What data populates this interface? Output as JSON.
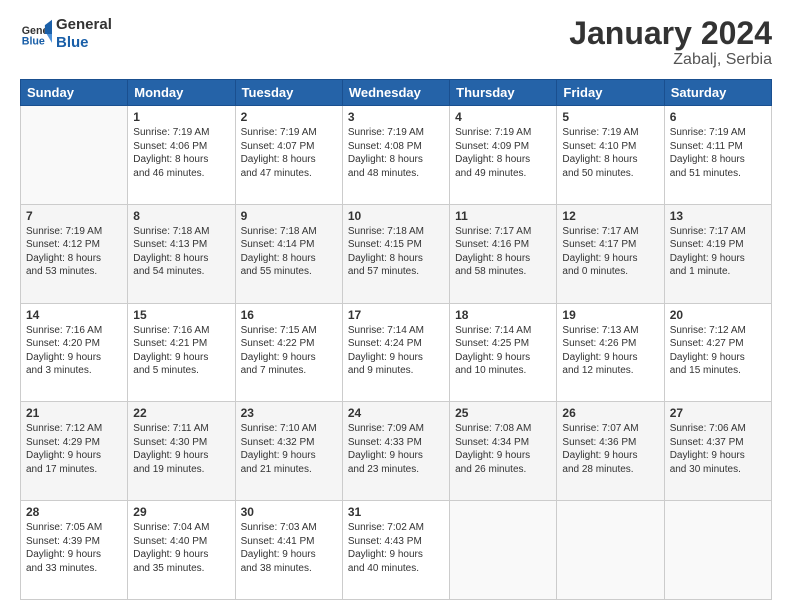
{
  "header": {
    "logo_line1": "General",
    "logo_line2": "Blue",
    "title": "January 2024",
    "subtitle": "Zabalj, Serbia"
  },
  "weekdays": [
    "Sunday",
    "Monday",
    "Tuesday",
    "Wednesday",
    "Thursday",
    "Friday",
    "Saturday"
  ],
  "weeks": [
    [
      {
        "day": "",
        "content": ""
      },
      {
        "day": "1",
        "content": "Sunrise: 7:19 AM\nSunset: 4:06 PM\nDaylight: 8 hours\nand 46 minutes."
      },
      {
        "day": "2",
        "content": "Sunrise: 7:19 AM\nSunset: 4:07 PM\nDaylight: 8 hours\nand 47 minutes."
      },
      {
        "day": "3",
        "content": "Sunrise: 7:19 AM\nSunset: 4:08 PM\nDaylight: 8 hours\nand 48 minutes."
      },
      {
        "day": "4",
        "content": "Sunrise: 7:19 AM\nSunset: 4:09 PM\nDaylight: 8 hours\nand 49 minutes."
      },
      {
        "day": "5",
        "content": "Sunrise: 7:19 AM\nSunset: 4:10 PM\nDaylight: 8 hours\nand 50 minutes."
      },
      {
        "day": "6",
        "content": "Sunrise: 7:19 AM\nSunset: 4:11 PM\nDaylight: 8 hours\nand 51 minutes."
      }
    ],
    [
      {
        "day": "7",
        "content": "Sunrise: 7:19 AM\nSunset: 4:12 PM\nDaylight: 8 hours\nand 53 minutes."
      },
      {
        "day": "8",
        "content": "Sunrise: 7:18 AM\nSunset: 4:13 PM\nDaylight: 8 hours\nand 54 minutes."
      },
      {
        "day": "9",
        "content": "Sunrise: 7:18 AM\nSunset: 4:14 PM\nDaylight: 8 hours\nand 55 minutes."
      },
      {
        "day": "10",
        "content": "Sunrise: 7:18 AM\nSunset: 4:15 PM\nDaylight: 8 hours\nand 57 minutes."
      },
      {
        "day": "11",
        "content": "Sunrise: 7:17 AM\nSunset: 4:16 PM\nDaylight: 8 hours\nand 58 minutes."
      },
      {
        "day": "12",
        "content": "Sunrise: 7:17 AM\nSunset: 4:17 PM\nDaylight: 9 hours\nand 0 minutes."
      },
      {
        "day": "13",
        "content": "Sunrise: 7:17 AM\nSunset: 4:19 PM\nDaylight: 9 hours\nand 1 minute."
      }
    ],
    [
      {
        "day": "14",
        "content": "Sunrise: 7:16 AM\nSunset: 4:20 PM\nDaylight: 9 hours\nand 3 minutes."
      },
      {
        "day": "15",
        "content": "Sunrise: 7:16 AM\nSunset: 4:21 PM\nDaylight: 9 hours\nand 5 minutes."
      },
      {
        "day": "16",
        "content": "Sunrise: 7:15 AM\nSunset: 4:22 PM\nDaylight: 9 hours\nand 7 minutes."
      },
      {
        "day": "17",
        "content": "Sunrise: 7:14 AM\nSunset: 4:24 PM\nDaylight: 9 hours\nand 9 minutes."
      },
      {
        "day": "18",
        "content": "Sunrise: 7:14 AM\nSunset: 4:25 PM\nDaylight: 9 hours\nand 10 minutes."
      },
      {
        "day": "19",
        "content": "Sunrise: 7:13 AM\nSunset: 4:26 PM\nDaylight: 9 hours\nand 12 minutes."
      },
      {
        "day": "20",
        "content": "Sunrise: 7:12 AM\nSunset: 4:27 PM\nDaylight: 9 hours\nand 15 minutes."
      }
    ],
    [
      {
        "day": "21",
        "content": "Sunrise: 7:12 AM\nSunset: 4:29 PM\nDaylight: 9 hours\nand 17 minutes."
      },
      {
        "day": "22",
        "content": "Sunrise: 7:11 AM\nSunset: 4:30 PM\nDaylight: 9 hours\nand 19 minutes."
      },
      {
        "day": "23",
        "content": "Sunrise: 7:10 AM\nSunset: 4:32 PM\nDaylight: 9 hours\nand 21 minutes."
      },
      {
        "day": "24",
        "content": "Sunrise: 7:09 AM\nSunset: 4:33 PM\nDaylight: 9 hours\nand 23 minutes."
      },
      {
        "day": "25",
        "content": "Sunrise: 7:08 AM\nSunset: 4:34 PM\nDaylight: 9 hours\nand 26 minutes."
      },
      {
        "day": "26",
        "content": "Sunrise: 7:07 AM\nSunset: 4:36 PM\nDaylight: 9 hours\nand 28 minutes."
      },
      {
        "day": "27",
        "content": "Sunrise: 7:06 AM\nSunset: 4:37 PM\nDaylight: 9 hours\nand 30 minutes."
      }
    ],
    [
      {
        "day": "28",
        "content": "Sunrise: 7:05 AM\nSunset: 4:39 PM\nDaylight: 9 hours\nand 33 minutes."
      },
      {
        "day": "29",
        "content": "Sunrise: 7:04 AM\nSunset: 4:40 PM\nDaylight: 9 hours\nand 35 minutes."
      },
      {
        "day": "30",
        "content": "Sunrise: 7:03 AM\nSunset: 4:41 PM\nDaylight: 9 hours\nand 38 minutes."
      },
      {
        "day": "31",
        "content": "Sunrise: 7:02 AM\nSunset: 4:43 PM\nDaylight: 9 hours\nand 40 minutes."
      },
      {
        "day": "",
        "content": ""
      },
      {
        "day": "",
        "content": ""
      },
      {
        "day": "",
        "content": ""
      }
    ]
  ]
}
